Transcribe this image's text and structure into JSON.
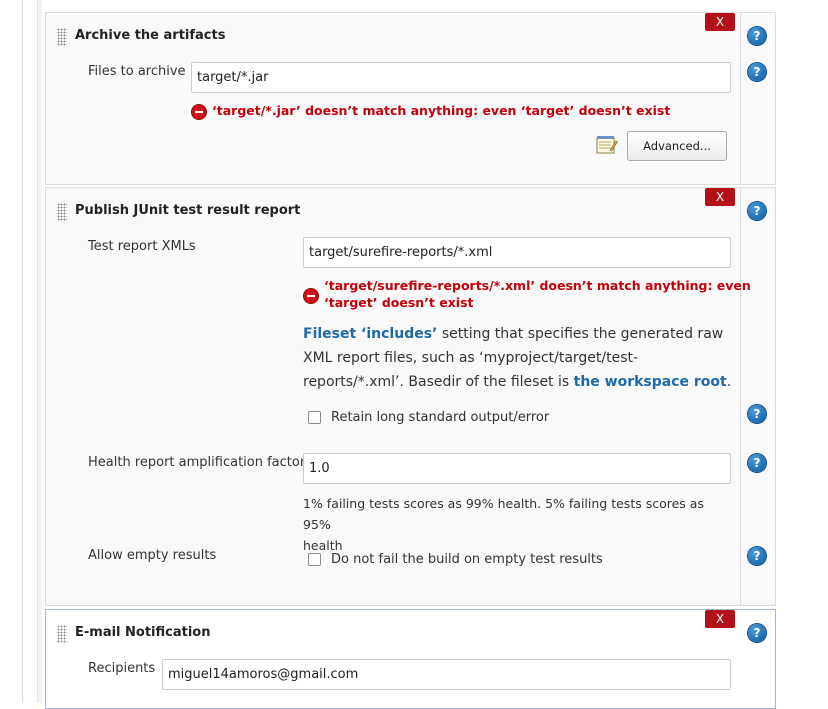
{
  "archive": {
    "title": "Archive the artifacts",
    "delete_label": "X",
    "files_label": "Files to archive",
    "files_value": "target/*.jar",
    "error": "‘target/*.jar’ doesn’t match anything: even ‘target’ doesn’t exist",
    "advanced_label": "Advanced..."
  },
  "junit": {
    "title": "Publish JUnit test result report",
    "delete_label": "X",
    "xml_label": "Test report XMLs",
    "xml_value": "target/surefire-reports/*.xml",
    "error_line1": "‘target/surefire-reports/*.xml’ doesn’t match anything: even",
    "error_line2": "‘target’ doesn’t exist",
    "desc": {
      "link1": "Fileset ‘includes’",
      "text1": " setting that specifies the generated raw",
      "line2": "XML report files, such as ‘myproject/target/test-",
      "line3a": "reports/*.xml’. Basedir of the fileset is ",
      "link2": "the workspace root",
      "line3b": "."
    },
    "retain_label": "Retain long standard output/error",
    "health_label": "Health report amplification factor",
    "health_value": "1.0",
    "health_help_line1": "1% failing tests scores as 99% health. 5% failing tests scores as 95%",
    "health_help_line2": "health",
    "allow_empty_label": "Allow empty results",
    "allow_empty_checkbox": "Do not fail the build on empty test results"
  },
  "email": {
    "title": "E-mail Notification",
    "delete_label": "X",
    "recipients_label": "Recipients",
    "recipients_value": "miguel14amoros@gmail.com"
  },
  "help_glyph": "?",
  "icons": {
    "drag": "drag-handle-icon",
    "help": "help-icon",
    "error": "error-icon",
    "notepad": "notepad-icon"
  },
  "colors": {
    "delete": "#b3101a",
    "error": "#c4000a",
    "link": "#1e6aa8",
    "help": "#0b5aa3"
  }
}
